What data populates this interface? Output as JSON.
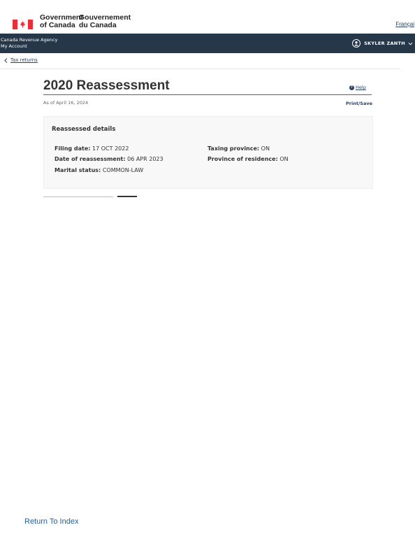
{
  "header": {
    "wordmark_en_line1": "Government",
    "wordmark_en_line2": "of Canada",
    "wordmark_fr_line1": "Gouvernement",
    "wordmark_fr_line2": "du Canada",
    "language_link": "Françai"
  },
  "app_bar": {
    "agency": "Canada Revenue Agency",
    "section": "My Account",
    "user_name": "SKYLER ZANTH",
    "background_color": "#26374a",
    "user_icon": "user-circle-icon"
  },
  "breadcrumb": {
    "label": "Tax returns",
    "icon": "chevron-left-icon"
  },
  "main": {
    "title": "2020 Reassessment",
    "help_label": "Help",
    "as_of": "As of April 16, 2024",
    "print_label": "Print/Save",
    "accent_color": "#af3c43"
  },
  "details": {
    "heading": "Reassessed details",
    "filing_date_label": "Filing date:",
    "filing_date_value": "17 OCT 2022",
    "reassessment_date_label": "Date of reassessment:",
    "reassessment_date_value": "06 APR 2023",
    "marital_status_label": "Marital status:",
    "marital_status_value": "COMMON-LAW",
    "taxing_province_label": "Taxing province:",
    "taxing_province_value": "ON",
    "province_residence_label": "Province of residence:",
    "province_residence_value": "ON"
  },
  "footer": {
    "return_link": "Return To Index"
  }
}
